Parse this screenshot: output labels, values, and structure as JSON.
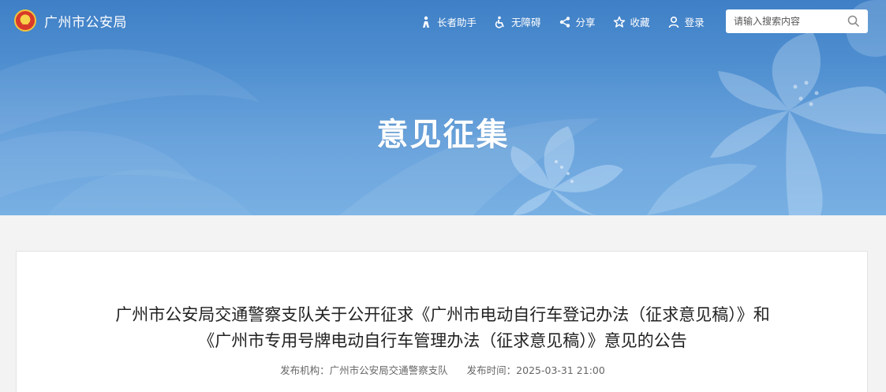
{
  "header": {
    "site_name": "广州市公安局",
    "tools": [
      {
        "label": "长者助手",
        "icon": "elder-assist-icon"
      },
      {
        "label": "无障碍",
        "icon": "accessibility-icon"
      },
      {
        "label": "分享",
        "icon": "share-icon"
      },
      {
        "label": "收藏",
        "icon": "star-icon"
      },
      {
        "label": "登录",
        "icon": "user-icon"
      }
    ],
    "search": {
      "placeholder": "请输入搜索内容",
      "value": ""
    }
  },
  "banner": {
    "title": "意见征集"
  },
  "article": {
    "title_line1": "广州市公安局交通警察支队关于公开征求《广州市电动自行车登记办法（征求意见稿）》和",
    "title_line2": "《广州市专用号牌电动自行车管理办法（征求意见稿）》意见的公告",
    "publisher": "发布机构：广州市公安局交通警察支队",
    "publish_time": "发布时间：2025-03-31 21:00"
  },
  "colors": {
    "banner_top": "#3f7fc6",
    "banner_bottom": "#78b0e3",
    "page_bg": "#f3f3f3",
    "card_bg": "#ffffff"
  }
}
